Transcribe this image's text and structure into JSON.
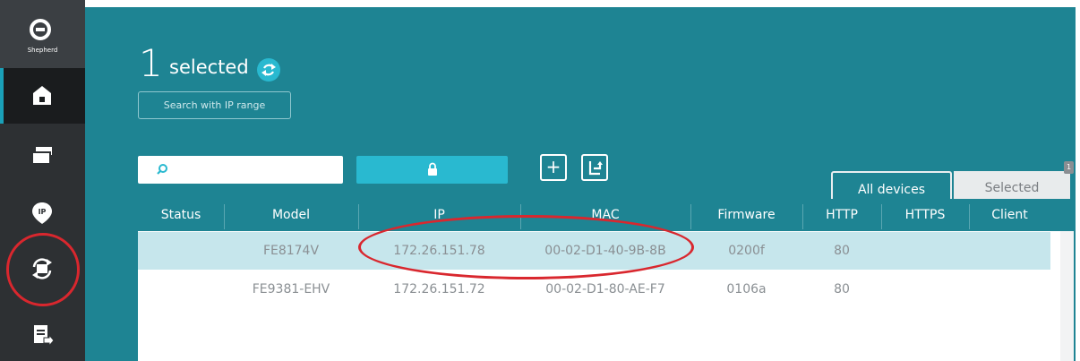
{
  "app": {
    "logo_text": "Shepherd"
  },
  "sidebar": {
    "items": [
      {
        "icon": "home-icon"
      },
      {
        "icon": "devices-icon"
      },
      {
        "icon": "ip-icon"
      },
      {
        "icon": "sync-icon"
      },
      {
        "icon": "export-list-icon"
      }
    ],
    "active_index": 0
  },
  "header": {
    "selected_count": "1",
    "selected_label": "selected",
    "search_ip_range": "Search with IP range"
  },
  "toolbar": {
    "search_placeholder": "",
    "add_label": "+",
    "export_icon": "export-icon",
    "lock_icon": "lock-icon"
  },
  "tabs": {
    "all_devices": "All devices",
    "selected": "Selected",
    "selected_badge": "1"
  },
  "table": {
    "columns": [
      "Status",
      "Model",
      "IP",
      "MAC",
      "Firmware",
      "HTTP",
      "HTTPS",
      "Client"
    ],
    "rows": [
      {
        "status": "",
        "model": "FE8174V",
        "ip": "172.26.151.78",
        "mac": "00-02-D1-40-9B-8B",
        "firmware": "0200f",
        "http": "80",
        "https": "",
        "client": ""
      },
      {
        "status": "",
        "model": "FE9381-EHV",
        "ip": "172.26.151.72",
        "mac": "00-02-D1-80-AE-F7",
        "firmware": "0106a",
        "http": "80",
        "https": "",
        "client": ""
      }
    ]
  },
  "colors": {
    "accent": "#29b9d0",
    "panel": "#1e8493",
    "sidebar": "#2d3033",
    "annotation": "#d9272e"
  }
}
